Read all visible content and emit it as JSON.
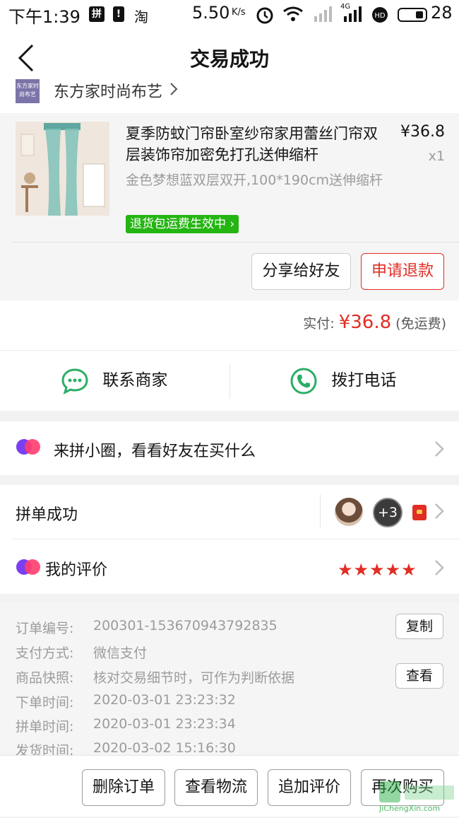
{
  "status_bar": {
    "time": "下午1:39",
    "icon_pin": "拼",
    "icon_tao": "淘",
    "speed": "5.50",
    "speed_unit": "K/s",
    "network": "4G",
    "battery": "28"
  },
  "nav": {
    "title": "交易成功"
  },
  "store": {
    "name": "东方家时尚布艺",
    "logo_text": "东方家时尚布艺"
  },
  "product": {
    "title": "夏季防蚊门帘卧室纱帘家用蕾丝门帘双层装饰帘加密免打孔送伸缩杆",
    "price": "¥36.8",
    "quantity": "x1",
    "spec": "金色梦想蓝双层双开,100*190cm送伸缩杆",
    "badge": "退货包运费生效中",
    "share_label": "分享给好友",
    "refund_label": "申请退款"
  },
  "payment": {
    "label": "实付:",
    "amount": "¥36.8",
    "note": "(免运费)"
  },
  "contact": {
    "merchant_label": "联系商家",
    "call_label": "拨打电话"
  },
  "circle": {
    "label": "来拼小圈，看看好友在买什么"
  },
  "group": {
    "label": "拼单成功",
    "extra_count": "+3"
  },
  "review": {
    "label": "我的评价",
    "rating": 5,
    "stars": "★★★★★"
  },
  "order_info": [
    {
      "label": "订单编号:",
      "value": "200301-153670943792835",
      "action": "复制"
    },
    {
      "label": "支付方式:",
      "value": "微信支付"
    },
    {
      "label": "商品快照:",
      "value": "核对交易细节时，可作为判断依据",
      "action": "查看"
    },
    {
      "label": "下单时间:",
      "value": "2020-03-01 23:23:32"
    },
    {
      "label": "拼单时间:",
      "value": "2020-03-01 23:23:34"
    },
    {
      "label": "发货时间:",
      "value": "2020-03-02 15:16:30"
    }
  ],
  "bottom_actions": {
    "delete": "删除订单",
    "logistics": "查看物流",
    "add_review": "追加评价",
    "rebuy": "再次购买"
  },
  "watermark": {
    "text": "JiChengXin.com"
  },
  "colors": {
    "brand_red": "#e02e24",
    "green": "#25b513",
    "wechat_green": "#2aae67"
  }
}
